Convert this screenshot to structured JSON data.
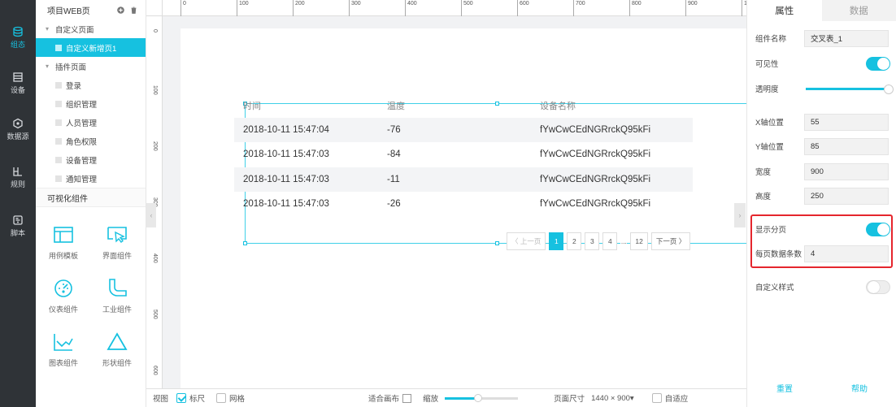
{
  "nav": [
    {
      "label": "组态",
      "icon": "layers-icon",
      "active": true
    },
    {
      "label": "设备",
      "icon": "device-icon",
      "active": false
    },
    {
      "label": "数据源",
      "icon": "database-icon",
      "active": false
    },
    {
      "label": "规则",
      "icon": "rule-icon",
      "active": false
    },
    {
      "label": "脚本",
      "icon": "script-icon",
      "active": false
    }
  ],
  "tree": {
    "title": "项目WEB页",
    "custom_group": "自定义页面",
    "custom_item": "自定义新增页1",
    "plugin_group": "插件页面",
    "plugin_items": [
      "登录",
      "组织管理",
      "人员管理",
      "角色权限",
      "设备管理",
      "通知管理"
    ]
  },
  "components": {
    "title": "可视化组件",
    "items": [
      {
        "label": "用例模板",
        "icon": "template-icon"
      },
      {
        "label": "界面组件",
        "icon": "cursor-window-icon"
      },
      {
        "label": "仪表组件",
        "icon": "gauge-icon"
      },
      {
        "label": "工业组件",
        "icon": "pipe-icon"
      },
      {
        "label": "图表组件",
        "icon": "line-chart-icon"
      },
      {
        "label": "形状组件",
        "icon": "triangle-icon"
      }
    ]
  },
  "ruler": {
    "top": [
      "0",
      "100",
      "200",
      "300",
      "400",
      "500",
      "600",
      "700",
      "800",
      "900",
      "10"
    ],
    "left": [
      "0",
      "100",
      "200",
      "300",
      "400",
      "500",
      "600"
    ]
  },
  "table": {
    "headers": [
      "时间",
      "温度",
      "设备名称"
    ],
    "rows": [
      [
        "2018-10-11 15:47:04",
        "-76",
        "fYwCwCEdNGRrckQ95kFi"
      ],
      [
        "2018-10-11 15:47:03",
        "-84",
        "fYwCwCEdNGRrckQ95kFi"
      ],
      [
        "2018-10-11 15:47:03",
        "-11",
        "fYwCwCEdNGRrckQ95kFi"
      ],
      [
        "2018-10-11 15:47:03",
        "-26",
        "fYwCwCEdNGRrckQ95kFi"
      ]
    ],
    "pager": {
      "prev": "〈 上一页",
      "pages": [
        "1",
        "2",
        "3",
        "4",
        "...",
        "12"
      ],
      "current": "1",
      "next": "下一页 〉"
    }
  },
  "bottombar": {
    "view": "视图",
    "ruler": "标尺",
    "grid": "网格",
    "fit": "适合画布",
    "zoom": "缩放",
    "zoom_level": 0.45,
    "page_size_label": "页面尺寸",
    "page_size_value": "1440 × 900▾",
    "adaptive": "自适应"
  },
  "panel": {
    "tab_props": "属性",
    "tab_data": "数据",
    "name_label": "组件名称",
    "name_value": "交叉表_1",
    "visible_label": "可见性",
    "opacity_label": "透明度",
    "x_label": "X轴位置",
    "x_value": "55",
    "y_label": "Y轴位置",
    "y_value": "85",
    "w_label": "宽度",
    "w_value": "900",
    "h_label": "高度",
    "h_value": "250",
    "paging_label": "显示分页",
    "per_page_label": "每页数据条数",
    "per_page_value": "4",
    "custom_style_label": "自定义样式",
    "reset": "重置",
    "help": "帮助"
  },
  "colors": {
    "accent": "#16c1e0",
    "highlight": "#e5262d",
    "nav_bg": "#2f3337"
  }
}
